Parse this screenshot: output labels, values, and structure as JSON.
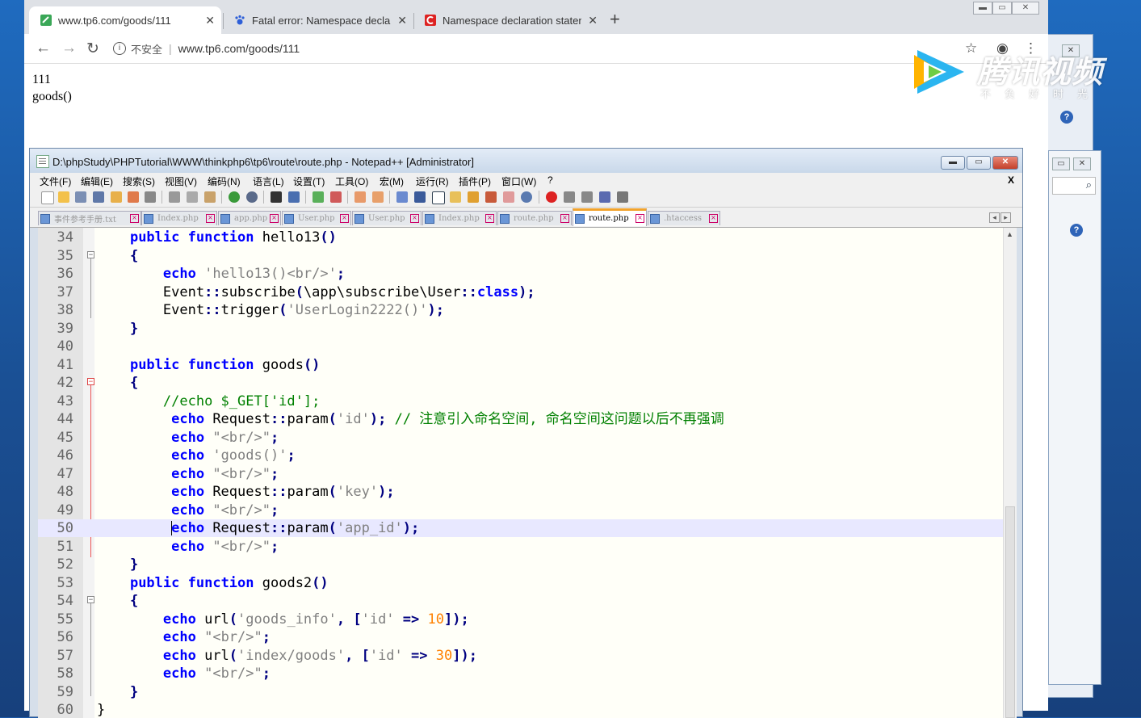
{
  "browser": {
    "tabs": [
      {
        "title": "www.tp6.com/goods/111",
        "favicon": "green-link-icon",
        "active": true
      },
      {
        "title": "Fatal error: Namespace declara",
        "favicon": "paw-icon",
        "active": false
      },
      {
        "title": "Namespace declaration staten",
        "favicon": "red-c-icon",
        "active": false
      }
    ],
    "new_tab": "+",
    "security_label": "不安全",
    "url": "www.tp6.com/goods/111",
    "page_lines": [
      "111",
      "goods()"
    ]
  },
  "watermark": {
    "brand": "腾讯视频",
    "slogan": "不负好时光"
  },
  "notepad": {
    "title": "D:\\phpStudy\\PHPTutorial\\WWW\\thinkphp6\\tp6\\route\\route.php - Notepad++ [Administrator]",
    "menu": [
      "文件(F)",
      "编辑(E)",
      "搜索(S)",
      "视图(V)",
      "编码(N)",
      "语言(L)",
      "设置(T)",
      "工具(O)",
      "宏(M)",
      "运行(R)",
      "插件(P)",
      "窗口(W)",
      "?"
    ],
    "menu_close": "X",
    "file_tabs": [
      {
        "label": "事件参考手册.txt",
        "active": false
      },
      {
        "label": "Index.php",
        "active": false
      },
      {
        "label": "app.php",
        "active": false
      },
      {
        "label": "User.php",
        "active": false
      },
      {
        "label": "User.php",
        "active": false
      },
      {
        "label": "Index.php",
        "active": false
      },
      {
        "label": "route.php",
        "active": false
      },
      {
        "label": "route.php",
        "active": true
      },
      {
        "label": ".htaccess",
        "active": false
      }
    ],
    "current_line": 50,
    "lines": [
      {
        "n": "34",
        "tokens": [
          [
            "",
            "    "
          ],
          [
            "kw",
            "public"
          ],
          [
            "",
            " "
          ],
          [
            "kw",
            "function"
          ],
          [
            "idn",
            " hello13"
          ],
          [
            "op",
            "()"
          ]
        ]
      },
      {
        "n": "35",
        "tokens": [
          [
            "",
            "    "
          ],
          [
            "op",
            "{"
          ]
        ]
      },
      {
        "n": "36",
        "tokens": [
          [
            "",
            "        "
          ],
          [
            "kw",
            "echo"
          ],
          [
            "",
            " "
          ],
          [
            "str",
            "'hello13()<br/>'"
          ],
          [
            "op",
            ";"
          ]
        ]
      },
      {
        "n": "37",
        "tokens": [
          [
            "",
            "        "
          ],
          [
            "idn",
            "Event"
          ],
          [
            "op",
            "::"
          ],
          [
            "idn",
            "subscribe"
          ],
          [
            "op",
            "("
          ],
          [
            "idn",
            "\\app\\subscribe\\User"
          ],
          [
            "op",
            "::"
          ],
          [
            "kw",
            "class"
          ],
          [
            "op",
            ");"
          ]
        ]
      },
      {
        "n": "38",
        "tokens": [
          [
            "",
            "        "
          ],
          [
            "idn",
            "Event"
          ],
          [
            "op",
            "::"
          ],
          [
            "idn",
            "trigger"
          ],
          [
            "op",
            "("
          ],
          [
            "str",
            "'UserLogin2222()'"
          ],
          [
            "op",
            ");"
          ]
        ]
      },
      {
        "n": "39",
        "tokens": [
          [
            "",
            "    "
          ],
          [
            "op",
            "}"
          ]
        ]
      },
      {
        "n": "40",
        "tokens": []
      },
      {
        "n": "41",
        "tokens": [
          [
            "",
            "    "
          ],
          [
            "kw",
            "public"
          ],
          [
            "",
            " "
          ],
          [
            "kw",
            "function"
          ],
          [
            "idn",
            " goods"
          ],
          [
            "op",
            "()"
          ]
        ]
      },
      {
        "n": "42",
        "tokens": [
          [
            "",
            "    "
          ],
          [
            "op",
            "{"
          ]
        ]
      },
      {
        "n": "43",
        "tokens": [
          [
            "",
            "        "
          ],
          [
            "cm",
            "//echo $_GET['id'];"
          ]
        ]
      },
      {
        "n": "44",
        "tokens": [
          [
            "",
            "         "
          ],
          [
            "kw",
            "echo"
          ],
          [
            "idn",
            " Request"
          ],
          [
            "op",
            "::"
          ],
          [
            "idn",
            "param"
          ],
          [
            "op",
            "("
          ],
          [
            "str",
            "'id'"
          ],
          [
            "op",
            ");"
          ],
          [
            "",
            " "
          ],
          [
            "cm",
            "// 注意引入命名空间, 命名空间这问题以后不再强调"
          ]
        ]
      },
      {
        "n": "45",
        "tokens": [
          [
            "",
            "         "
          ],
          [
            "kw",
            "echo"
          ],
          [
            "",
            " "
          ],
          [
            "str",
            "\"<br/>\""
          ],
          [
            "op",
            ";"
          ]
        ]
      },
      {
        "n": "46",
        "tokens": [
          [
            "",
            "         "
          ],
          [
            "kw",
            "echo"
          ],
          [
            "",
            " "
          ],
          [
            "str",
            "'goods()'"
          ],
          [
            "op",
            ";"
          ]
        ]
      },
      {
        "n": "47",
        "tokens": [
          [
            "",
            "         "
          ],
          [
            "kw",
            "echo"
          ],
          [
            "",
            " "
          ],
          [
            "str",
            "\"<br/>\""
          ],
          [
            "op",
            ";"
          ]
        ]
      },
      {
        "n": "48",
        "tokens": [
          [
            "",
            "         "
          ],
          [
            "kw",
            "echo"
          ],
          [
            "idn",
            " Request"
          ],
          [
            "op",
            "::"
          ],
          [
            "idn",
            "param"
          ],
          [
            "op",
            "("
          ],
          [
            "str",
            "'key'"
          ],
          [
            "op",
            ");"
          ]
        ]
      },
      {
        "n": "49",
        "tokens": [
          [
            "",
            "         "
          ],
          [
            "kw",
            "echo"
          ],
          [
            "",
            " "
          ],
          [
            "str",
            "\"<br/>\""
          ],
          [
            "op",
            ";"
          ]
        ]
      },
      {
        "n": "50",
        "tokens": [
          [
            "",
            "         "
          ],
          [
            "cursor",
            ""
          ],
          [
            "kw",
            "echo"
          ],
          [
            "idn",
            " Request"
          ],
          [
            "op",
            "::"
          ],
          [
            "idn",
            "param"
          ],
          [
            "op",
            "("
          ],
          [
            "str",
            "'app_id'"
          ],
          [
            "op",
            ");"
          ]
        ]
      },
      {
        "n": "51",
        "tokens": [
          [
            "",
            "         "
          ],
          [
            "kw",
            "echo"
          ],
          [
            "",
            " "
          ],
          [
            "str",
            "\"<br/>\""
          ],
          [
            "op",
            ";"
          ]
        ]
      },
      {
        "n": "52",
        "tokens": [
          [
            "",
            "    "
          ],
          [
            "op",
            "}"
          ]
        ]
      },
      {
        "n": "53",
        "tokens": [
          [
            "",
            "    "
          ],
          [
            "kw",
            "public"
          ],
          [
            "",
            " "
          ],
          [
            "kw",
            "function"
          ],
          [
            "idn",
            " goods2"
          ],
          [
            "op",
            "()"
          ]
        ]
      },
      {
        "n": "54",
        "tokens": [
          [
            "",
            "    "
          ],
          [
            "op",
            "{"
          ]
        ]
      },
      {
        "n": "55",
        "tokens": [
          [
            "",
            "        "
          ],
          [
            "kw",
            "echo"
          ],
          [
            "idn",
            " url"
          ],
          [
            "op",
            "("
          ],
          [
            "str",
            "'goods_info'"
          ],
          [
            "op",
            ", ["
          ],
          [
            "str",
            "'id'"
          ],
          [
            "op",
            " => "
          ],
          [
            "num",
            "10"
          ],
          [
            "op",
            "]);"
          ]
        ]
      },
      {
        "n": "56",
        "tokens": [
          [
            "",
            "        "
          ],
          [
            "kw",
            "echo"
          ],
          [
            "",
            " "
          ],
          [
            "str",
            "\"<br/>\""
          ],
          [
            "op",
            ";"
          ]
        ]
      },
      {
        "n": "57",
        "tokens": [
          [
            "",
            "        "
          ],
          [
            "kw",
            "echo"
          ],
          [
            "idn",
            " url"
          ],
          [
            "op",
            "("
          ],
          [
            "str",
            "'index/goods'"
          ],
          [
            "op",
            ", ["
          ],
          [
            "str",
            "'id'"
          ],
          [
            "op",
            " => "
          ],
          [
            "num",
            "30"
          ],
          [
            "op",
            "]);"
          ]
        ]
      },
      {
        "n": "58",
        "tokens": [
          [
            "",
            "        "
          ],
          [
            "kw",
            "echo"
          ],
          [
            "",
            " "
          ],
          [
            "str",
            "\"<br/>\""
          ],
          [
            "op",
            ";"
          ]
        ]
      },
      {
        "n": "59",
        "tokens": [
          [
            "",
            "    "
          ],
          [
            "op",
            "}"
          ]
        ]
      },
      {
        "n": "60",
        "tokens": [
          [
            "",
            "}"
          ]
        ]
      }
    ]
  }
}
